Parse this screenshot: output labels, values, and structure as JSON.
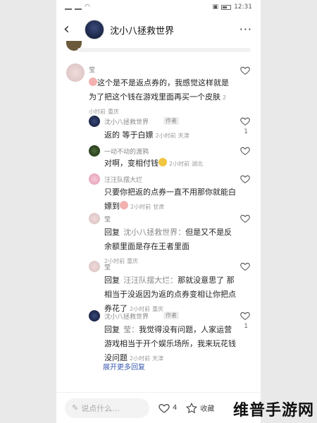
{
  "status_bar": {
    "time": "12:31",
    "left_text": "ᵒ⁸ ᵒ⁸"
  },
  "header": {
    "title": "沈小八拯救世界",
    "more": "···"
  },
  "comments": [
    {
      "name": "莹",
      "text": "这个是不是返点券的，我感觉这样就是为了把这个钱在游戏里面再买一个皮肤",
      "time": "2小时前",
      "location": "重庆"
    },
    {
      "name": "沈小八拯救世界",
      "role": "作者",
      "text": "返的 等于白嫖",
      "time": "2小时前",
      "location": "天津",
      "likes": "1"
    },
    {
      "name": "一动不动的渡鸦",
      "text": "对啊，变相付钱",
      "time": "2小时前",
      "location": "湖北"
    },
    {
      "name": "汪汪队摆大烂",
      "text": "只要你把返的点券一直不用那你就能白嫖到",
      "time": "2小时前",
      "location": "甘肃"
    },
    {
      "name": "莹",
      "reply_prefix": "回复",
      "reply_to": "沈小八拯救世界：",
      "text": "但是又不是反余额里面是存在王者里面",
      "time": "2小时前",
      "location": "重庆"
    },
    {
      "name": "莹",
      "reply_prefix": "回复",
      "reply_to": "汪汪队摆大烂：",
      "text": "那就没意思了 那相当于没返因为返的点券变相让你把点券花了",
      "time": "2小时前",
      "location": "重庆"
    },
    {
      "name": "沈小八拯救世界",
      "role": "作者",
      "reply_prefix": "回复",
      "reply_to": "莹：",
      "text": "我觉得没有问题，人家运营游戏相当于开个娱乐场所，我来玩花钱没问题",
      "time": "2小时前",
      "location": "天津",
      "likes": "1"
    }
  ],
  "expand_replies": "展开更多回复",
  "bottom_bar": {
    "placeholder": "说点什么...",
    "like_count": "4",
    "favorite_label": "收藏"
  },
  "watermark": "维普手游网",
  "colors": {
    "link": "#3b5bb0",
    "background": "#ffffff",
    "page_bg": "#e9e9e9"
  }
}
